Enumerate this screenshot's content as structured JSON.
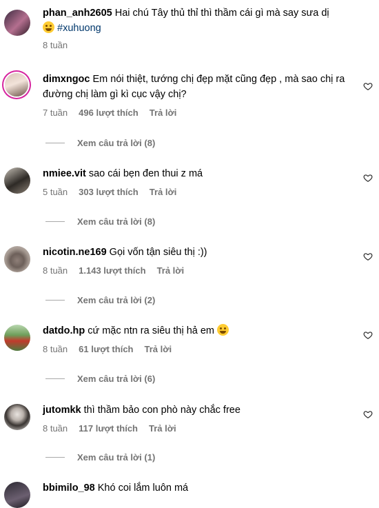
{
  "comments": [
    {
      "username": "phan_anh2605",
      "text": "Hai chú Tây thủ thỉ thì thầm cái gì mà say sưa dị",
      "emoji": "rolling-laughing-emoji",
      "hashtag": "#xuhuong",
      "time": "8 tuần",
      "likes": "",
      "reply": "",
      "view_replies": ""
    },
    {
      "username": "dimxngoc",
      "text": "Em nói thiệt, tướng chị đẹp mặt cũng đẹp , mà sao chị ra đường chị làm gì kì cục vậy chị?",
      "time": "7 tuần",
      "likes": "496 lượt thích",
      "reply": "Trả lời",
      "view_replies": "Xem câu trả lời (8)"
    },
    {
      "username": "nmiee.vit",
      "text": "sao cái bẹn đen thui z má",
      "time": "5 tuần",
      "likes": "303 lượt thích",
      "reply": "Trả lời",
      "view_replies": "Xem câu trả lời (8)"
    },
    {
      "username": "nicotin.ne169",
      "text": "Gọi vốn tận siêu thị :))",
      "time": "8 tuần",
      "likes": "1.143 lượt thích",
      "reply": "Trả lời",
      "view_replies": "Xem câu trả lời (2)"
    },
    {
      "username": "datdo.hp",
      "text": "cứ mặc ntn ra siêu thị hả em",
      "emoji": "laughing-emoji",
      "time": "8 tuần",
      "likes": "61 lượt thích",
      "reply": "Trả lời",
      "view_replies": "Xem câu trả lời (6)"
    },
    {
      "username": "jutomkk",
      "text": "thì thầm bảo con phò này chắc free",
      "time": "8 tuần",
      "likes": "117 lượt thích",
      "reply": "Trả lời",
      "view_replies": "Xem câu trả lời (1)"
    },
    {
      "username": "bbimilo_98",
      "text": "Khó coi lắm luôn má",
      "time": "",
      "likes": "",
      "reply": "",
      "view_replies": ""
    }
  ],
  "colors": {
    "meta": "#737373",
    "link": "#00376b",
    "ring": "#d6249f"
  },
  "icons": {
    "like": "heart-outline-icon"
  }
}
